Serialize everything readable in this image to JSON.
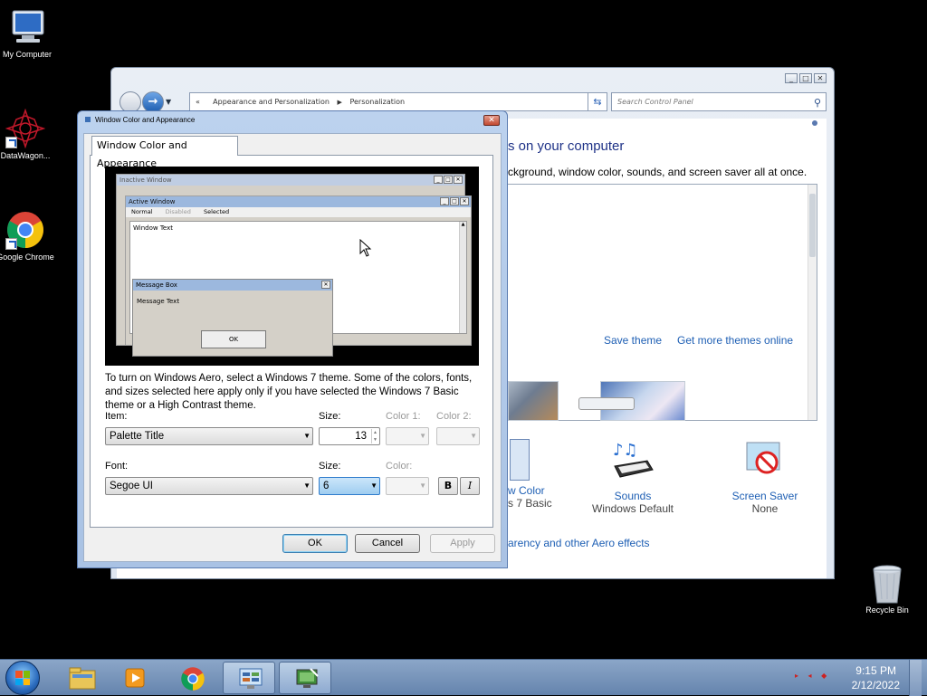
{
  "desktop": {
    "icons": [
      {
        "label": "My Computer"
      },
      {
        "label": "DataWagon..."
      },
      {
        "label": "Google Chrome"
      },
      {
        "label": "Recycle Bin"
      }
    ]
  },
  "control_panel": {
    "address": {
      "crumbs": [
        "Appearance and Personalization",
        "Personalization"
      ],
      "search_placeholder": "Search Control Panel"
    },
    "heading": "s on your computer",
    "description": "ckground, window color, sounds, and screen saver all at once.",
    "save_theme": "Save theme",
    "get_more_themes": "Get more themes online",
    "window_color": {
      "name": "w Color",
      "value": "s 7 Basic"
    },
    "sounds": {
      "name": "Sounds",
      "value": "Windows Default"
    },
    "screen_saver": {
      "name": "Screen Saver",
      "value": "None"
    },
    "aero_link": "arency and other Aero effects"
  },
  "dialog": {
    "title": "Window Color and Appearance",
    "tab": "Window Color and Appearance",
    "preview": {
      "inactive_title": "Inactive Window",
      "active_title": "Active Window",
      "menu": [
        "Normal",
        "Disabled",
        "Selected"
      ],
      "window_text": "Window Text",
      "msgbox_title": "Message Box",
      "msgbox_text": "Message Text",
      "msgbox_ok": "OK"
    },
    "info": "To turn on Windows Aero, select a Windows 7 theme.  Some of the colors, fonts, and sizes selected here apply only if you have selected the Windows 7 Basic theme or a High Contrast theme.",
    "labels": {
      "item": "Item:",
      "size": "Size:",
      "color1": "Color 1:",
      "color2": "Color 2:",
      "font": "Font:",
      "color": "Color:"
    },
    "item_value": "Palette Title",
    "item_size": "13",
    "font_value": "Segoe UI",
    "font_size": "6",
    "bold": "B",
    "italic": "I",
    "buttons": {
      "ok": "OK",
      "cancel": "Cancel",
      "apply": "Apply"
    }
  },
  "taskbar": {
    "time": "9:15 PM",
    "date": "2/12/2022"
  }
}
